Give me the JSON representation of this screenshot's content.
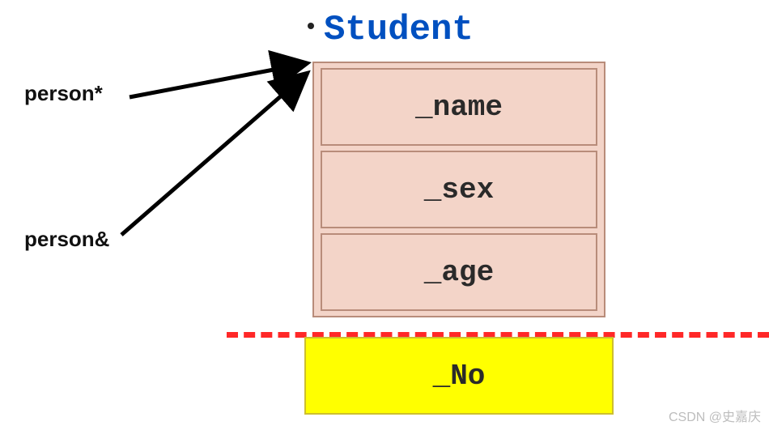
{
  "title": "Student",
  "labels": {
    "pointer": "person*",
    "reference": "person&"
  },
  "members": {
    "base": [
      "_name",
      "_sex",
      "_age"
    ],
    "derived": "_No"
  },
  "watermark": "CSDN @史嘉庆"
}
